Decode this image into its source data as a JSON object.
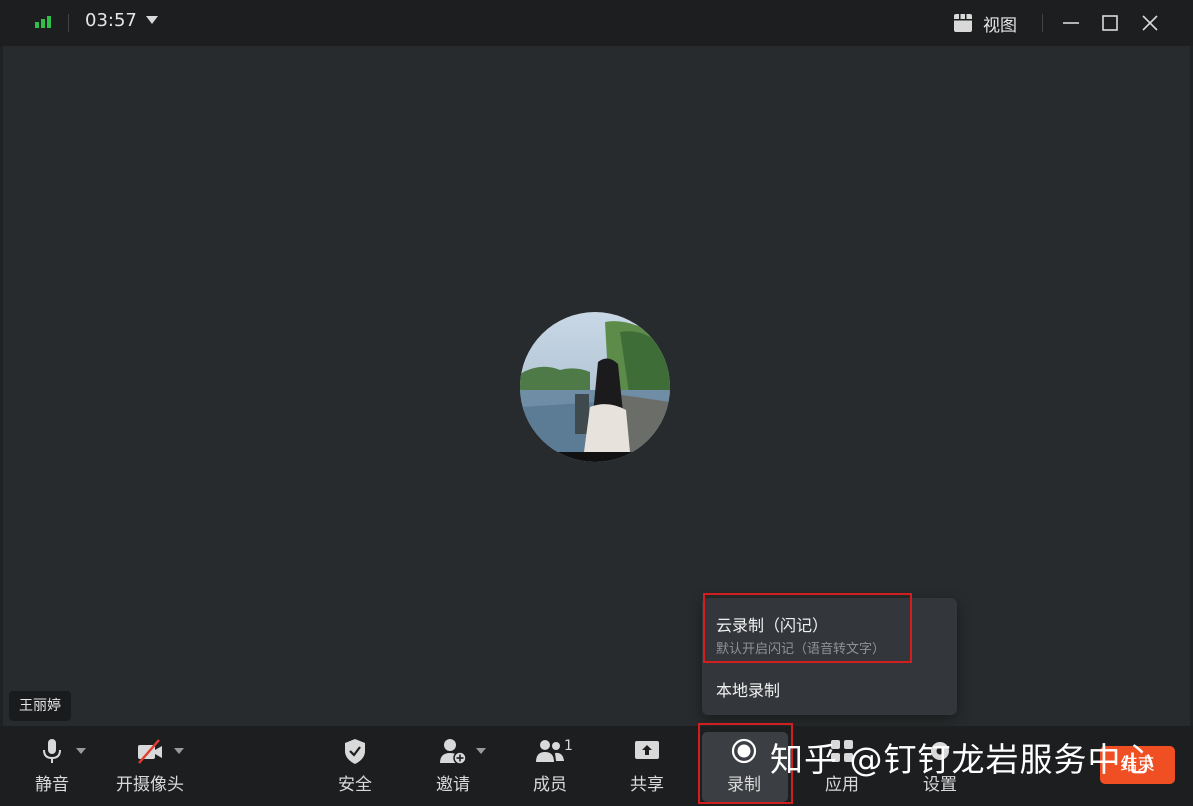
{
  "titlebar": {
    "time": "03:57",
    "view_label": "视图"
  },
  "participant": {
    "name": "王丽婷"
  },
  "record_menu": {
    "cloud_title": "云录制（闪记）",
    "cloud_subtitle": "默认开启闪记（语音转文字）",
    "local_title": "本地录制"
  },
  "toolbar": {
    "mute_label": "静音",
    "camera_label": "开摄像头",
    "security_label": "安全",
    "invite_label": "邀请",
    "members_label": "成员",
    "members_count": "1",
    "share_label": "共享",
    "record_label": "录制",
    "apps_label": "应用",
    "settings_label": "设置",
    "end_label": "结束"
  },
  "watermark": "知乎 @钉钉龙岩服务中心",
  "colors": {
    "signal": "#2fbf4a",
    "end_button": "#f04e23",
    "highlight": "#d11e1e",
    "popup_bg": "#33363a"
  }
}
